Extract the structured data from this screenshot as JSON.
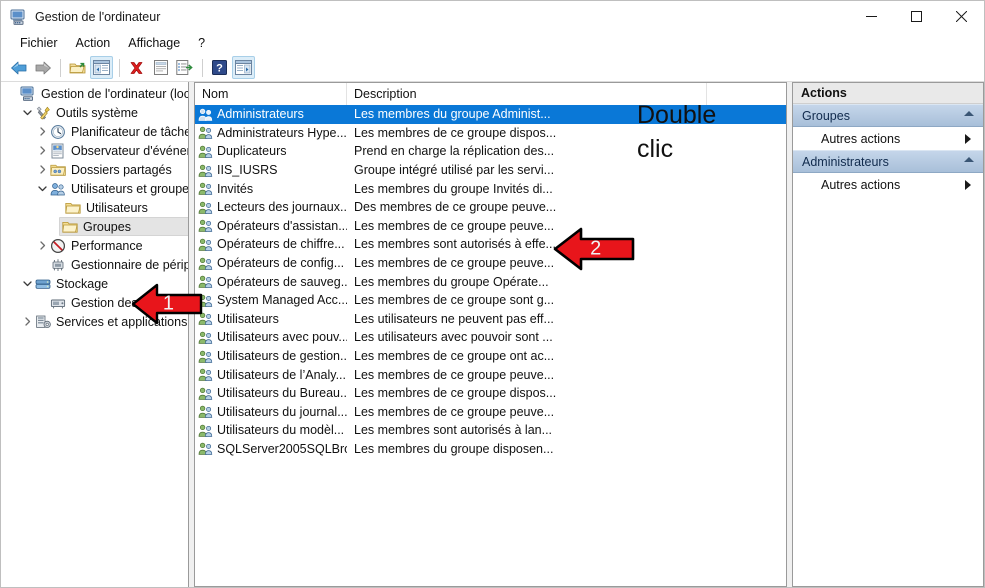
{
  "window": {
    "title": "Gestion de l'ordinateur",
    "icon": "computer-management-icon",
    "minimize": "—",
    "maximize": "☐",
    "close": "✕"
  },
  "menubar": {
    "items": [
      {
        "label": "Fichier",
        "name": "menu-fichier"
      },
      {
        "label": "Action",
        "name": "menu-action"
      },
      {
        "label": "Affichage",
        "name": "menu-affichage"
      },
      {
        "label": "?",
        "name": "menu-aide"
      }
    ]
  },
  "toolbar": {
    "buttons": [
      {
        "name": "back-icon",
        "glyph": "←"
      },
      {
        "name": "forward-icon",
        "glyph": "→"
      },
      {
        "name": "up-folder-icon",
        "glyph": "⬆"
      },
      {
        "name": "show-hide-tree-icon",
        "glyph": "▤"
      },
      {
        "name": "delete-icon",
        "glyph": "✕"
      },
      {
        "name": "properties-icon",
        "glyph": "▥"
      },
      {
        "name": "export-list-icon",
        "glyph": "☰"
      },
      {
        "name": "help-icon",
        "glyph": "?"
      },
      {
        "name": "show-action-pane-icon",
        "glyph": "▤"
      }
    ]
  },
  "tree": {
    "items": [
      {
        "label": "Gestion de l'ordinateur (local)",
        "indent": 0,
        "expander": "none",
        "icon": "computer-icon"
      },
      {
        "label": "Outils système",
        "indent": 1,
        "expander": "expanded",
        "icon": "system-tools-icon"
      },
      {
        "label": "Planificateur de tâches",
        "indent": 2,
        "expander": "collapsed",
        "icon": "clock-icon"
      },
      {
        "label": "Observateur d'événements",
        "indent": 2,
        "expander": "collapsed",
        "icon": "event-viewer-icon"
      },
      {
        "label": "Dossiers partagés",
        "indent": 2,
        "expander": "collapsed",
        "icon": "shared-folders-icon"
      },
      {
        "label": "Utilisateurs et groupes l",
        "indent": 2,
        "expander": "expanded",
        "icon": "users-groups-icon"
      },
      {
        "label": "Utilisateurs",
        "indent": 3,
        "expander": "none",
        "icon": "folder-icon"
      },
      {
        "label": "Groupes",
        "indent": 3,
        "expander": "none",
        "icon": "folder-icon",
        "selected": true
      },
      {
        "label": "Performance",
        "indent": 2,
        "expander": "collapsed",
        "icon": "performance-icon"
      },
      {
        "label": "Gestionnaire de périphé",
        "indent": 2,
        "expander": "none",
        "icon": "device-manager-icon"
      },
      {
        "label": "Stockage",
        "indent": 1,
        "expander": "expanded",
        "icon": "storage-icon"
      },
      {
        "label": "Gestion des disques",
        "indent": 2,
        "expander": "none",
        "icon": "disk-icon"
      },
      {
        "label": "Services et applications",
        "indent": 1,
        "expander": "collapsed",
        "icon": "services-icon"
      }
    ]
  },
  "list": {
    "columns": [
      {
        "label": "Nom",
        "name": "column-nom"
      },
      {
        "label": "Description",
        "name": "column-description"
      },
      {
        "label": "",
        "name": "column-filler"
      }
    ],
    "rows": [
      {
        "name": "Administrateurs",
        "description": "Les membres du groupe Administ...",
        "selected": true
      },
      {
        "name": "Administrateurs Hype...",
        "description": "Les membres de ce groupe dispos..."
      },
      {
        "name": "Duplicateurs",
        "description": "Prend en charge la réplication des..."
      },
      {
        "name": "IIS_IUSRS",
        "description": "Groupe intégré utilisé par les servi..."
      },
      {
        "name": "Invités",
        "description": "Les membres du groupe Invités di..."
      },
      {
        "name": "Lecteurs des journaux...",
        "description": "Des membres de ce groupe peuve..."
      },
      {
        "name": "Opérateurs d'assistan...",
        "description": "Les membres de ce groupe peuve..."
      },
      {
        "name": "Opérateurs de chiffre...",
        "description": "Les membres sont autorisés à effe..."
      },
      {
        "name": "Opérateurs de config...",
        "description": "Les membres de ce groupe peuve..."
      },
      {
        "name": "Opérateurs de sauveg...",
        "description": "Les membres du groupe Opérate..."
      },
      {
        "name": "System Managed Acc...",
        "description": "Les membres de ce groupe sont g..."
      },
      {
        "name": "Utilisateurs",
        "description": "Les utilisateurs ne peuvent pas eff..."
      },
      {
        "name": "Utilisateurs avec pouv...",
        "description": "Les utilisateurs avec pouvoir sont ..."
      },
      {
        "name": "Utilisateurs de gestion...",
        "description": "Les membres de ce groupe ont ac..."
      },
      {
        "name": "Utilisateurs de l’Analy...",
        "description": "Les membres de ce groupe peuve..."
      },
      {
        "name": "Utilisateurs du Bureau...",
        "description": "Les membres de ce groupe dispos..."
      },
      {
        "name": "Utilisateurs du journal...",
        "description": "Les membres de ce groupe peuve..."
      },
      {
        "name": "Utilisateurs du modèl...",
        "description": "Les membres sont autorisés à lan..."
      },
      {
        "name": "SQLServer2005SQLBro...",
        "description": "Les membres du groupe disposen..."
      }
    ]
  },
  "actions": {
    "title": "Actions",
    "groups": [
      {
        "header": "Groupes",
        "items": [
          {
            "label": "Autres actions"
          }
        ]
      },
      {
        "header": "Administrateurs",
        "items": [
          {
            "label": "Autres actions"
          }
        ]
      }
    ]
  },
  "annotations": {
    "arrow1": {
      "number": "1",
      "color": "#e8151b"
    },
    "arrow2": {
      "number": "2",
      "color": "#e8151b"
    },
    "caption_line1": "Double",
    "caption_line2": "clic"
  }
}
